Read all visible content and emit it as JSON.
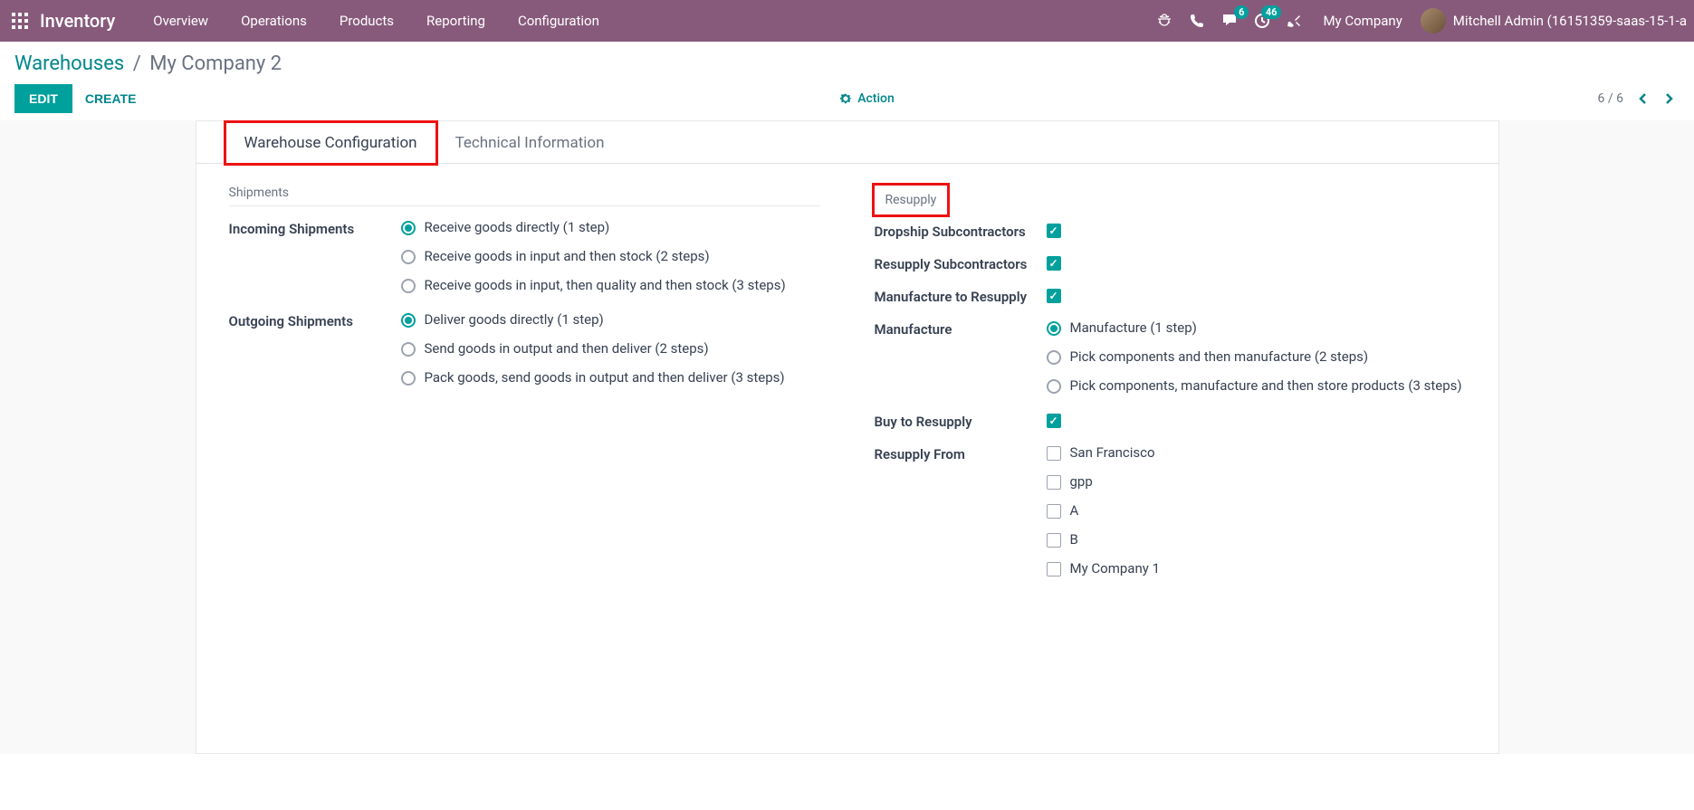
{
  "navbar": {
    "app_title": "Inventory",
    "menu": [
      "Overview",
      "Operations",
      "Products",
      "Reporting",
      "Configuration"
    ],
    "messaging_badge": "6",
    "activity_badge": "46",
    "company": "My Company",
    "user": "Mitchell Admin (16151359-saas-15-1-a"
  },
  "breadcrumb": {
    "parent": "Warehouses",
    "current": "My Company 2"
  },
  "buttons": {
    "edit": "EDIT",
    "create": "CREATE",
    "action": "Action"
  },
  "pager": {
    "text": "6 / 6"
  },
  "tabs": [
    {
      "label": "Warehouse Configuration",
      "active": true,
      "highlighted": true
    },
    {
      "label": "Technical Information",
      "active": false,
      "highlighted": false
    }
  ],
  "shipments": {
    "section_title": "Shipments",
    "incoming": {
      "label": "Incoming Shipments",
      "options": [
        {
          "label": "Receive goods directly (1 step)",
          "selected": true
        },
        {
          "label": "Receive goods in input and then stock (2 steps)",
          "selected": false
        },
        {
          "label": "Receive goods in input, then quality and then stock (3 steps)",
          "selected": false
        }
      ]
    },
    "outgoing": {
      "label": "Outgoing Shipments",
      "options": [
        {
          "label": "Deliver goods directly (1 step)",
          "selected": true
        },
        {
          "label": "Send goods in output and then deliver (2 steps)",
          "selected": false
        },
        {
          "label": "Pack goods, send goods in output and then deliver (3 steps)",
          "selected": false
        }
      ]
    }
  },
  "resupply": {
    "section_title": "Resupply",
    "dropship_subcontractors": {
      "label": "Dropship Subcontractors",
      "checked": true
    },
    "resupply_subcontractors": {
      "label": "Resupply Subcontractors",
      "checked": true
    },
    "manufacture_to_resupply": {
      "label": "Manufacture to Resupply",
      "checked": true
    },
    "manufacture": {
      "label": "Manufacture",
      "options": [
        {
          "label": "Manufacture (1 step)",
          "selected": true
        },
        {
          "label": "Pick components and then manufacture (2 steps)",
          "selected": false
        },
        {
          "label": "Pick components, manufacture and then store products (3 steps)",
          "selected": false
        }
      ]
    },
    "buy_to_resupply": {
      "label": "Buy to Resupply",
      "checked": true
    },
    "resupply_from": {
      "label": "Resupply From",
      "options": [
        {
          "label": "San Francisco",
          "checked": false
        },
        {
          "label": "gpp",
          "checked": false
        },
        {
          "label": "A",
          "checked": false
        },
        {
          "label": "B",
          "checked": false
        },
        {
          "label": "My Company 1",
          "checked": false
        }
      ]
    }
  }
}
